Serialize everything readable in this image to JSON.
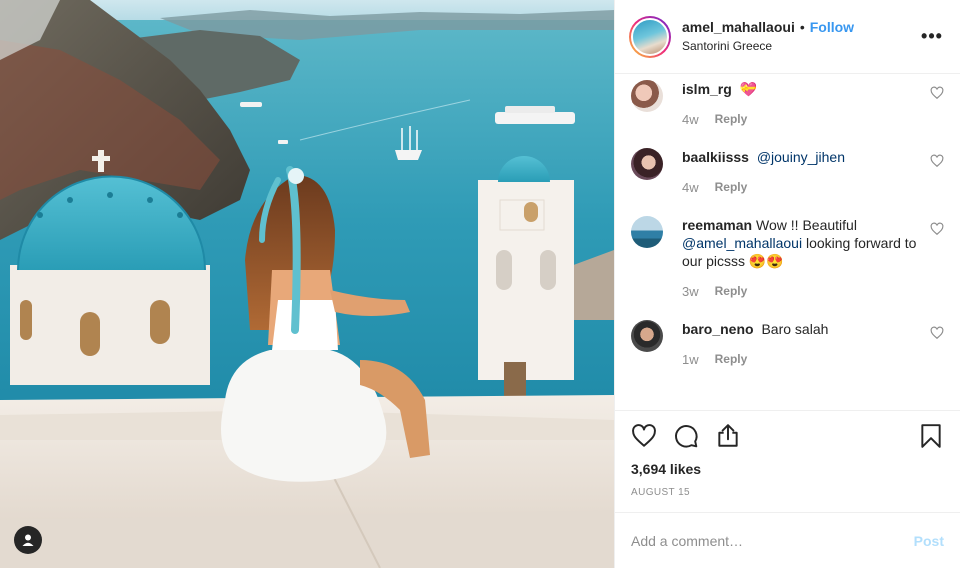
{
  "header": {
    "username": "amel_mahallaoui",
    "separator": "•",
    "follow_label": "Follow",
    "location": "Santorini Greece",
    "more_icon": "more-horizontal-icon",
    "more_glyph": "•••"
  },
  "comments": [
    {
      "username": "islm_rg",
      "text": "💝",
      "time": "4w",
      "reply": "Reply"
    },
    {
      "username": "baalkiisss",
      "mention": "@jouiny_jihen",
      "time": "4w",
      "reply": "Reply"
    },
    {
      "username": "reemaman",
      "text_before": "Wow !! Beautiful ",
      "mention": "@amel_mahallaoui",
      "text_after": " looking forward to our picsss 😍😍",
      "time": "3w",
      "reply": "Reply"
    },
    {
      "username": "baro_neno",
      "text": "Baro salah",
      "time": "1w",
      "reply": "Reply"
    }
  ],
  "actions": {
    "icons": [
      "heart-icon",
      "comment-icon",
      "share-icon",
      "bookmark-icon"
    ],
    "likes": "3,694 likes",
    "date": "AUGUST 15"
  },
  "add_comment": {
    "placeholder": "Add a comment…",
    "post_label": "Post"
  },
  "colors": {
    "link_blue": "#3897f0",
    "mention": "#003569",
    "muted": "#8e8e8e",
    "post_disabled": "#b2dffc",
    "text": "#262626"
  }
}
